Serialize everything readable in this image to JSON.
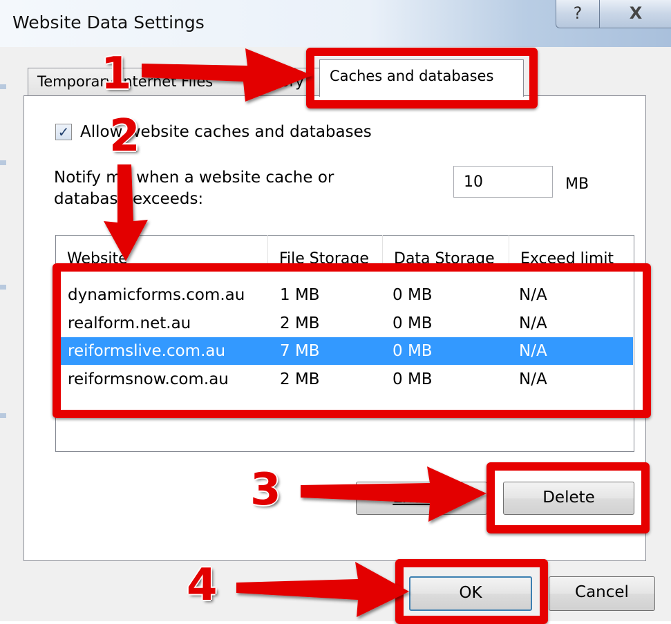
{
  "window": {
    "title": "Website Data Settings",
    "help_glyph": "?",
    "close_glyph": "X"
  },
  "tabs": [
    {
      "label": "Temporary Internet Files"
    },
    {
      "label": "History"
    },
    {
      "label": "Caches and databases",
      "selected": true
    }
  ],
  "settings": {
    "allow_label": "Allow website caches and databases",
    "allow_checked": true,
    "notify_label": "Notify me when a website cache or database exceeds:",
    "notify_value": "10",
    "notify_unit": "MB"
  },
  "site_table": {
    "columns": [
      "Website",
      "File Storage",
      "Data Storage",
      "Exceed limit"
    ],
    "rows": [
      {
        "website": "dynamicforms.com.au",
        "file_storage": "1 MB",
        "data_storage": "0 MB",
        "exceed_limit": "N/A",
        "selected": false
      },
      {
        "website": "realform.net.au",
        "file_storage": "2 MB",
        "data_storage": "0 MB",
        "exceed_limit": "N/A",
        "selected": false
      },
      {
        "website": "reiformslive.com.au",
        "file_storage": "7 MB",
        "data_storage": "0 MB",
        "exceed_limit": "N/A",
        "selected": true
      },
      {
        "website": "reiformsnow.com.au",
        "file_storage": "2 MB",
        "data_storage": "0 MB",
        "exceed_limit": "N/A",
        "selected": false
      }
    ]
  },
  "buttons": {
    "exceed_label": "Exceed",
    "delete_label": "Delete",
    "ok_label": "OK",
    "cancel_label": "Cancel"
  },
  "annotations": {
    "steps": [
      "1",
      "2",
      "3",
      "4"
    ],
    "color": "#e60000"
  },
  "colors": {
    "selection": "#3399ff",
    "dialog_background": "#f0f0f0"
  },
  "icons": {
    "checkbox_mark": "check-icon"
  }
}
